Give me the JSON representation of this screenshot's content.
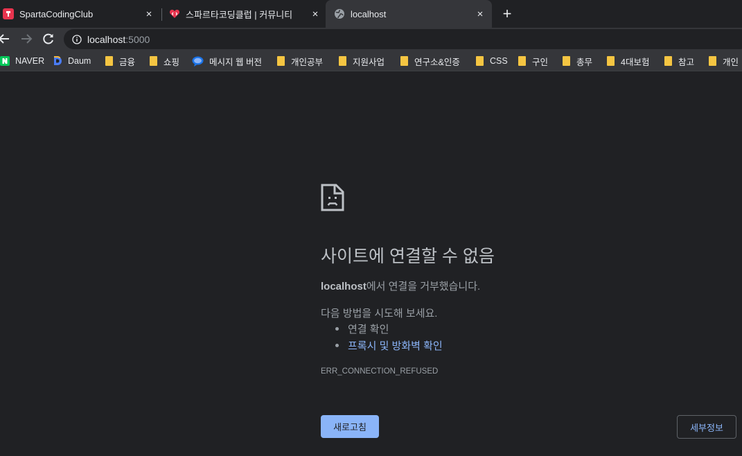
{
  "tabs": [
    {
      "title": "SpartaCodingClub",
      "favicon": "sparta-favicon",
      "close": "×"
    },
    {
      "title": "스파르타코딩클럽 | 커뮤니티",
      "favicon": "heart-code-favicon",
      "close": "×"
    },
    {
      "title": "localhost",
      "favicon": "globe-favicon",
      "close": "×"
    }
  ],
  "new_tab": "+",
  "address": {
    "host": "localhost",
    "port": ":5000"
  },
  "bookmarks": [
    {
      "label": "NAVER",
      "icon": "naver-icon"
    },
    {
      "label": "Daum",
      "icon": "daum-icon"
    },
    {
      "label": "금융",
      "icon": "folder-icon"
    },
    {
      "label": "쇼핑",
      "icon": "folder-icon"
    },
    {
      "label": "메시지 웹 버전",
      "icon": "messages-icon"
    },
    {
      "label": "개인공부",
      "icon": "folder-icon"
    },
    {
      "label": "지원사업",
      "icon": "folder-icon"
    },
    {
      "label": "연구소&인증",
      "icon": "folder-icon"
    },
    {
      "label": "CSS",
      "icon": "folder-icon"
    },
    {
      "label": "구인",
      "icon": "folder-icon"
    },
    {
      "label": "총무",
      "icon": "folder-icon"
    },
    {
      "label": "4대보험",
      "icon": "folder-icon"
    },
    {
      "label": "참고",
      "icon": "folder-icon"
    },
    {
      "label": "개인",
      "icon": "folder-icon"
    }
  ],
  "error": {
    "title": "사이트에 연결할 수 없음",
    "host": "localhost",
    "desc_suffix": "에서 연결을 거부했습니다.",
    "try_text": "다음 방법을 시도해 보세요.",
    "suggestions": [
      "연결 확인",
      "프록시 및 방화벽 확인"
    ],
    "code": "ERR_CONNECTION_REFUSED",
    "reload_label": "새로고침",
    "details_label": "세부정보"
  },
  "colors": {
    "background": "#202124",
    "link": "#8ab4f8",
    "button": "#8ab4f8",
    "tab_active": "#35363a"
  }
}
